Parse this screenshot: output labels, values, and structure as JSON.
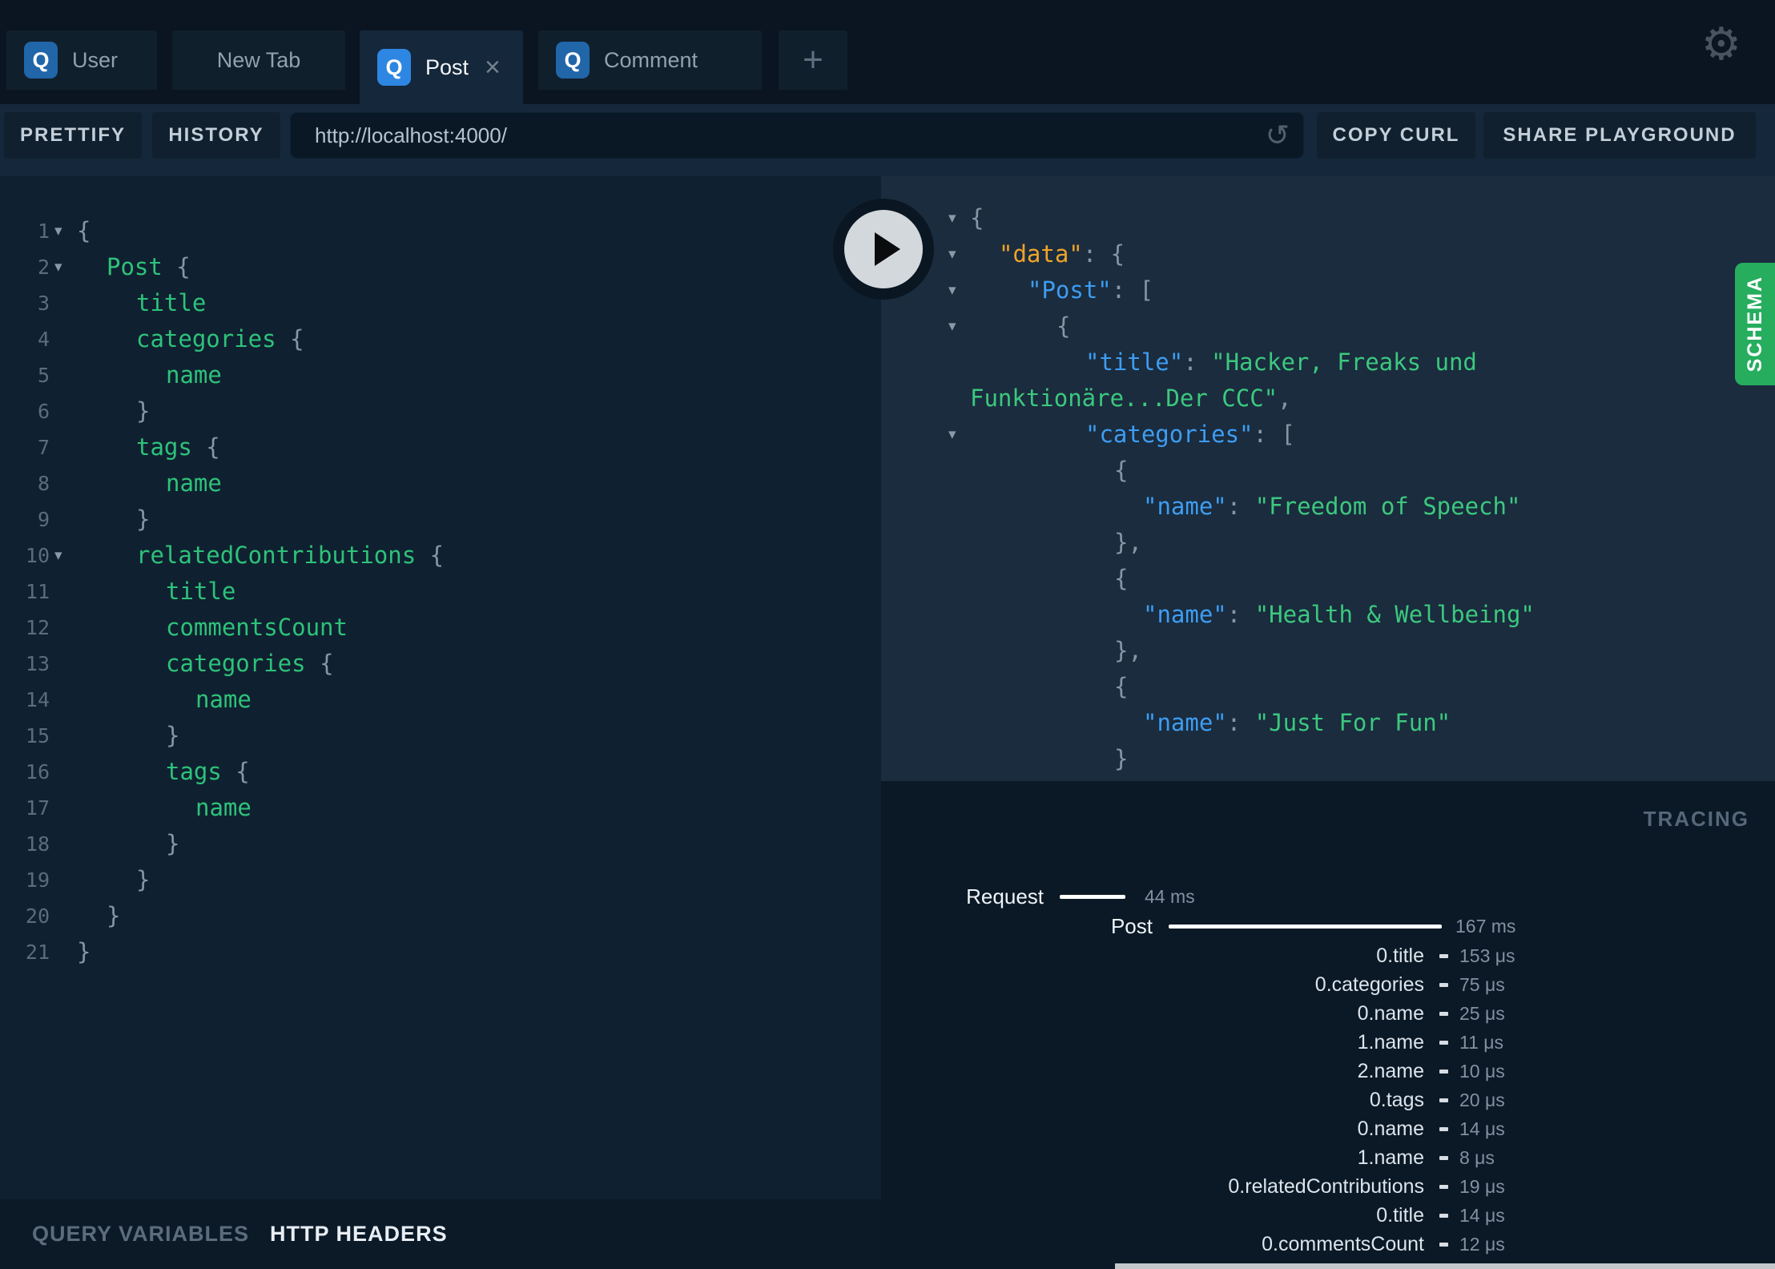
{
  "icons": {
    "settings": "⚙",
    "reload": "↺",
    "close": "×",
    "fold": "▾"
  },
  "topbar": {
    "tabs": [
      {
        "label": "User",
        "badge": "Q",
        "active": false,
        "closable": false
      },
      {
        "label": "New Tab",
        "badge": null,
        "active": false,
        "closable": false
      },
      {
        "label": "Post",
        "badge": "Q",
        "active": true,
        "closable": true
      },
      {
        "label": "Comment",
        "badge": "Q",
        "active": false,
        "closable": false
      }
    ],
    "new_tab_button": "+"
  },
  "toolbar": {
    "prettify": "PRETTIFY",
    "history": "HISTORY",
    "url": "http://localhost:4000/",
    "copy_curl": "COPY CURL",
    "share_playground": "SHARE PLAYGROUND"
  },
  "query_editor": {
    "lines": [
      {
        "n": 1,
        "i": 0,
        "a": true,
        "t": [
          [
            "w",
            "{"
          ]
        ]
      },
      {
        "n": 2,
        "i": 1,
        "a": true,
        "t": [
          [
            "f",
            "Post"
          ],
          [
            "w",
            " {"
          ]
        ]
      },
      {
        "n": 3,
        "i": 2,
        "a": false,
        "t": [
          [
            "f",
            "title"
          ]
        ]
      },
      {
        "n": 4,
        "i": 2,
        "a": false,
        "t": [
          [
            "f",
            "categories"
          ],
          [
            "w",
            " {"
          ]
        ]
      },
      {
        "n": 5,
        "i": 3,
        "a": false,
        "t": [
          [
            "f",
            "name"
          ]
        ]
      },
      {
        "n": 6,
        "i": 2,
        "a": false,
        "t": [
          [
            "w",
            "}"
          ]
        ]
      },
      {
        "n": 7,
        "i": 2,
        "a": false,
        "t": [
          [
            "f",
            "tags"
          ],
          [
            "w",
            " {"
          ]
        ]
      },
      {
        "n": 8,
        "i": 3,
        "a": false,
        "t": [
          [
            "f",
            "name"
          ]
        ]
      },
      {
        "n": 9,
        "i": 2,
        "a": false,
        "t": [
          [
            "w",
            "}"
          ]
        ]
      },
      {
        "n": 10,
        "i": 2,
        "a": true,
        "t": [
          [
            "f",
            "relatedContributions"
          ],
          [
            "w",
            " {"
          ]
        ]
      },
      {
        "n": 11,
        "i": 3,
        "a": false,
        "t": [
          [
            "f",
            "title"
          ]
        ]
      },
      {
        "n": 12,
        "i": 3,
        "a": false,
        "t": [
          [
            "f",
            "commentsCount"
          ]
        ]
      },
      {
        "n": 13,
        "i": 3,
        "a": false,
        "t": [
          [
            "f",
            "categories"
          ],
          [
            "w",
            " {"
          ]
        ]
      },
      {
        "n": 14,
        "i": 4,
        "a": false,
        "t": [
          [
            "f",
            "name"
          ]
        ]
      },
      {
        "n": 15,
        "i": 3,
        "a": false,
        "t": [
          [
            "w",
            "}"
          ]
        ]
      },
      {
        "n": 16,
        "i": 3,
        "a": false,
        "t": [
          [
            "f",
            "tags"
          ],
          [
            "w",
            " {"
          ]
        ]
      },
      {
        "n": 17,
        "i": 4,
        "a": false,
        "t": [
          [
            "f",
            "name"
          ]
        ]
      },
      {
        "n": 18,
        "i": 3,
        "a": false,
        "t": [
          [
            "w",
            "}"
          ]
        ]
      },
      {
        "n": 19,
        "i": 2,
        "a": false,
        "t": [
          [
            "w",
            "}"
          ]
        ]
      },
      {
        "n": 20,
        "i": 1,
        "a": false,
        "t": [
          [
            "w",
            "}"
          ]
        ]
      },
      {
        "n": 21,
        "i": 0,
        "a": false,
        "t": [
          [
            "w",
            "}"
          ]
        ]
      }
    ]
  },
  "response_viewer": {
    "lines": [
      {
        "i": 0,
        "a": true,
        "t": [
          [
            "w",
            "{"
          ]
        ]
      },
      {
        "i": 1,
        "a": true,
        "t": [
          [
            "o",
            "\"data\""
          ],
          [
            "w",
            ": {"
          ]
        ]
      },
      {
        "i": 2,
        "a": true,
        "t": [
          [
            "k",
            "\"Post\""
          ],
          [
            "w",
            ": ["
          ]
        ]
      },
      {
        "i": 3,
        "a": true,
        "t": [
          [
            "w",
            "{"
          ]
        ]
      },
      {
        "i": 4,
        "a": false,
        "t": [
          [
            "k",
            "\"title\""
          ],
          [
            "w",
            ": "
          ],
          [
            "s",
            "\"Hacker, Freaks und"
          ]
        ]
      },
      {
        "i": 0,
        "a": false,
        "t": [
          [
            "s",
            "Funktionäre...Der CCC\""
          ],
          [
            "w",
            ","
          ]
        ]
      },
      {
        "i": 4,
        "a": true,
        "t": [
          [
            "k",
            "\"categories\""
          ],
          [
            "w",
            ": ["
          ]
        ]
      },
      {
        "i": 5,
        "a": false,
        "t": [
          [
            "w",
            "{"
          ]
        ]
      },
      {
        "i": 6,
        "a": false,
        "t": [
          [
            "k",
            "\"name\""
          ],
          [
            "w",
            ": "
          ],
          [
            "s",
            "\"Freedom of Speech\""
          ]
        ]
      },
      {
        "i": 5,
        "a": false,
        "t": [
          [
            "w",
            "},"
          ]
        ]
      },
      {
        "i": 5,
        "a": false,
        "t": [
          [
            "w",
            "{"
          ]
        ]
      },
      {
        "i": 6,
        "a": false,
        "t": [
          [
            "k",
            "\"name\""
          ],
          [
            "w",
            ": "
          ],
          [
            "s",
            "\"Health & Wellbeing\""
          ]
        ]
      },
      {
        "i": 5,
        "a": false,
        "t": [
          [
            "w",
            "},"
          ]
        ]
      },
      {
        "i": 5,
        "a": false,
        "t": [
          [
            "w",
            "{"
          ]
        ]
      },
      {
        "i": 6,
        "a": false,
        "t": [
          [
            "k",
            "\"name\""
          ],
          [
            "w",
            ": "
          ],
          [
            "s",
            "\"Just For Fun\""
          ]
        ]
      },
      {
        "i": 5,
        "a": false,
        "t": [
          [
            "w",
            "}"
          ]
        ]
      },
      {
        "i": 4,
        "a": false,
        "t": [
          [
            "w",
            "]"
          ]
        ]
      }
    ]
  },
  "schema_tab": {
    "label": "SCHEMA",
    "color": "#26ad5e"
  },
  "tracing": {
    "title": "TRACING",
    "headers": [
      {
        "label": "Request",
        "value": "44 ms"
      },
      {
        "label": "Post",
        "value": "167 ms"
      }
    ],
    "rows": [
      {
        "label": "0.title",
        "value": "153 μs"
      },
      {
        "label": "0.categories",
        "value": "75 μs"
      },
      {
        "label": "0.name",
        "value": "25 μs"
      },
      {
        "label": "1.name",
        "value": "11 μs"
      },
      {
        "label": "2.name",
        "value": "10 μs"
      },
      {
        "label": "0.tags",
        "value": "20 μs"
      },
      {
        "label": "0.name",
        "value": "14 μs"
      },
      {
        "label": "1.name",
        "value": "8 μs"
      },
      {
        "label": "0.relatedContributions",
        "value": "19 μs"
      },
      {
        "label": "0.title",
        "value": "14 μs"
      },
      {
        "label": "0.commentsCount",
        "value": "12 μs"
      }
    ]
  },
  "bottom_bar": {
    "query_variables": "QUERY VARIABLES",
    "http_headers": "HTTP HEADERS"
  }
}
